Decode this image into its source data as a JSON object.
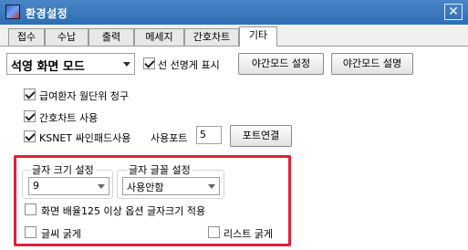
{
  "window": {
    "title": "환경설정",
    "close_glyph": "✕"
  },
  "tabs": [
    {
      "label": "접수"
    },
    {
      "label": "수납"
    },
    {
      "label": "출력"
    },
    {
      "label": "메세지"
    },
    {
      "label": "간호차트"
    },
    {
      "label": "기타"
    }
  ],
  "mode_select": {
    "value": "석영 화면 모드"
  },
  "options": {
    "show_name": "선 선명게 표시",
    "night_mode_settings": "야간모드 설정",
    "night_mode_description": "야간모드 설명",
    "monthly_claim": "급여환자 월단위 청구",
    "nursing_chart": "간호차트 사용",
    "ksnet": "KSNET 싸인패드사용",
    "port_label": "사용포트",
    "port_value": "5",
    "port_connect": "포트연결"
  },
  "font": {
    "size_label": "글자 크기 설정",
    "size_value": "9",
    "family_label": "글자 글꼴 설정",
    "family_value": "사용안함",
    "scale_option": "화면 배율125 이상  옵션 글자크기 적용",
    "bold_text": "글씨 굵게",
    "bold_list": "리스트 굵게"
  }
}
